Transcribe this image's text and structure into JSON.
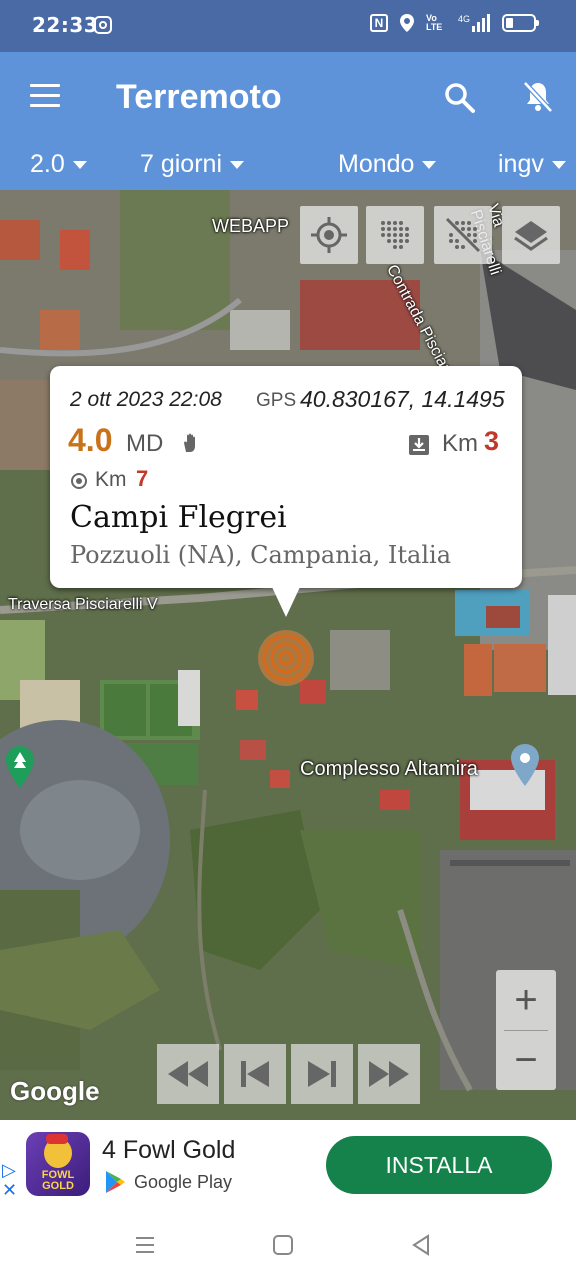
{
  "status_bar": {
    "time": "22:33",
    "volte": "Vo LTE",
    "network": "4G"
  },
  "app_bar": {
    "title": "Terremoto"
  },
  "filters": [
    {
      "label": "2.0"
    },
    {
      "label": "7 giorni"
    },
    {
      "label": "Mondo"
    },
    {
      "label": "ingv"
    }
  ],
  "map": {
    "labels": {
      "webapp": "WEBAPP",
      "road_pisciarelli": "Contrada Pisciarelli",
      "road_pisciarelli_2": "Via Pisciarelli",
      "traversa": "Traversa Pisciarelli V",
      "poi": "Complesso Altamira"
    },
    "google": "Google"
  },
  "popup": {
    "date": "2 ott 2023 22:08",
    "gps_label": "GPS",
    "gps": "40.830167, 14.1495",
    "magnitude": "4.0",
    "magnitude_type": "MD",
    "depth_unit": "Km",
    "depth": "3",
    "distance_unit": "Km",
    "distance": "7",
    "place": "Campi Flegrei",
    "region": "Pozzuoli (NA), Campania, Italia"
  },
  "ad": {
    "title": "4 Fowl Gold",
    "store": "Google Play",
    "cta": "INSTALLA",
    "icon_text": "FOWL GOLD"
  },
  "colors": {
    "app_bar": "#5f93d9",
    "status_bar": "#4a6aa6",
    "magnitude": "#c8731a",
    "depth": "#c0392b",
    "install": "#14824a"
  }
}
